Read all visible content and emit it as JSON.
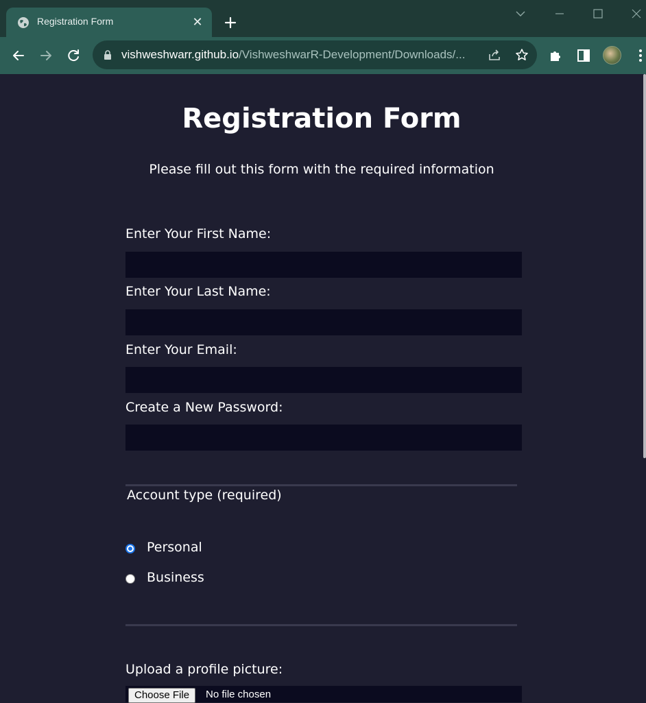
{
  "browser": {
    "tab_title": "Registration Form",
    "url_host": "vishweshwarr.github.io",
    "url_path": "/VishweshwarR-Development/Downloads/..."
  },
  "icons": {
    "favicon": "globe-icon",
    "new_tab": "plus-icon",
    "back": "arrow-left-icon",
    "forward": "arrow-right-icon",
    "reload": "reload-icon",
    "lock": "lock-icon",
    "share": "share-icon",
    "bookmark": "star-icon",
    "extensions": "puzzle-icon",
    "side_panel": "side-panel-icon",
    "menu": "kebab-menu-icon"
  },
  "form": {
    "title": "Registration Form",
    "subtitle": "Please fill out this form with the required information",
    "fields": [
      {
        "label": "Enter Your First Name:",
        "value": ""
      },
      {
        "label": "Enter Your Last Name:",
        "value": ""
      },
      {
        "label": "Enter Your Email:",
        "value": ""
      },
      {
        "label": "Create a New Password:",
        "value": ""
      }
    ],
    "account_type": {
      "legend": "Account type (required)",
      "options": [
        {
          "label": "Personal",
          "checked": true
        },
        {
          "label": "Business",
          "checked": false
        }
      ]
    },
    "upload": {
      "label": "Upload a profile picture:",
      "button": "Choose File",
      "status": "No file chosen"
    }
  },
  "colors": {
    "page_bg": "#1e1e30",
    "input_bg": "#0b0b1f",
    "chrome_tab": "#2d5e56",
    "radio_accent": "#1a73e8"
  }
}
